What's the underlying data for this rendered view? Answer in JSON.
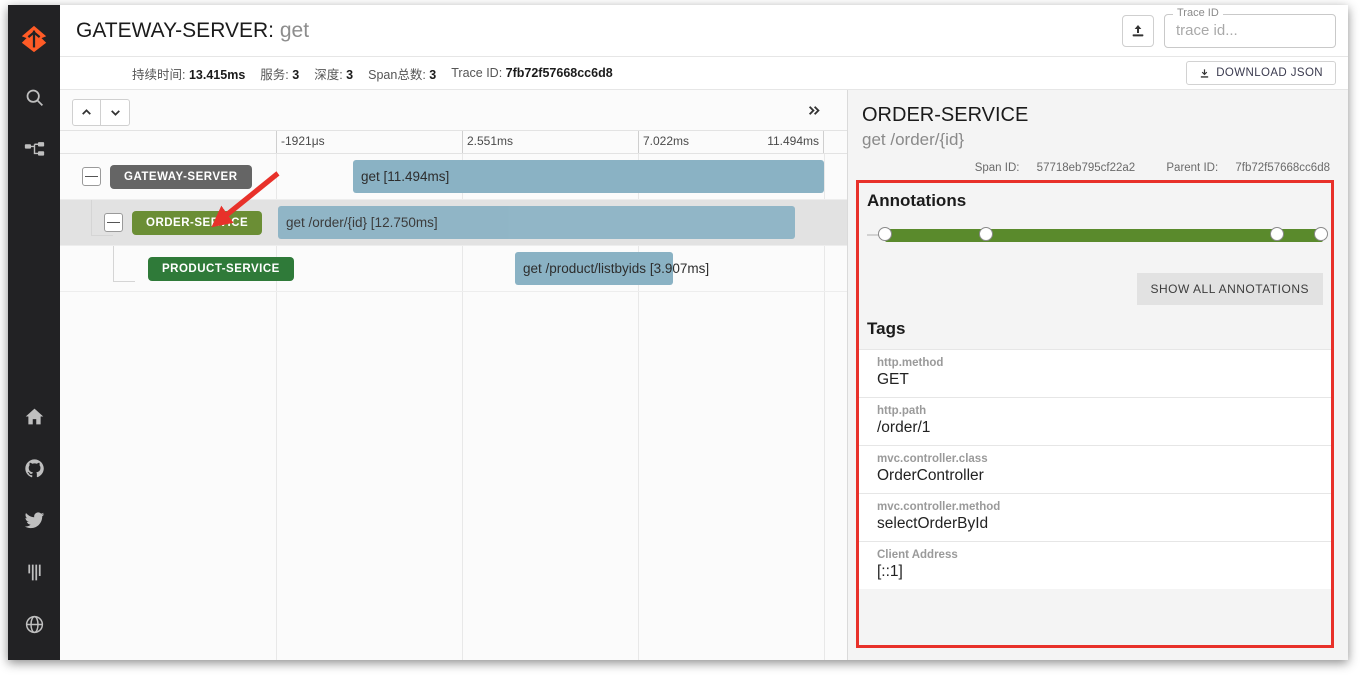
{
  "rail": {
    "items": [
      {
        "name": "zipkin-logo-icon",
        "label": "Zipkin"
      },
      {
        "name": "search-icon",
        "label": "Search"
      },
      {
        "name": "dependencies-icon",
        "label": "Dependencies"
      },
      {
        "name": "home-icon",
        "label": "Home"
      },
      {
        "name": "github-icon",
        "label": "GitHub"
      },
      {
        "name": "twitter-icon",
        "label": "Twitter"
      },
      {
        "name": "gitter-icon",
        "label": "Gitter"
      },
      {
        "name": "globe-icon",
        "label": "Language"
      }
    ]
  },
  "header": {
    "service": "GATEWAY-SERVER",
    "separator": ": ",
    "operation": "get",
    "upload_icon": "upload-icon",
    "traceid_legend": "Trace ID",
    "traceid_value": "",
    "traceid_placeholder": "trace id...",
    "download_label": "DOWNLOAD JSON"
  },
  "meta": [
    {
      "label": "持续时间:",
      "value": "13.415ms"
    },
    {
      "label": "服务:",
      "value": "3"
    },
    {
      "label": "深度:",
      "value": "3"
    },
    {
      "label": "Span总数:",
      "value": "3"
    },
    {
      "label": "Trace ID:",
      "value": "7fb72f57668cc6d8"
    }
  ],
  "timeline": {
    "collapse_all_icon": "chevron-up-icon",
    "expand_all_icon": "chevron-down-icon",
    "expand_detail_icon": "double-chevron-right-icon",
    "ticks": [
      "-1921μs",
      "2.551ms",
      "7.022ms",
      "11.494ms"
    ],
    "rows": [
      {
        "service": "GATEWAY-SERVER",
        "chip_color": "#656565",
        "span_label": "get [11.494ms]",
        "duration": "11.494ms",
        "selected": false,
        "has_toggle": true,
        "depth": 0
      },
      {
        "service": "ORDER-SERVICE",
        "chip_color": "#6b8e35",
        "span_label": "get /order/{id} [12.750ms]",
        "duration": "12.750ms",
        "selected": true,
        "has_toggle": true,
        "depth": 1
      },
      {
        "service": "PRODUCT-SERVICE",
        "chip_color": "#2f7a39",
        "span_label": "get /product/listbyids [3.907ms]",
        "duration": "3.907ms",
        "selected": false,
        "has_toggle": false,
        "depth": 2
      }
    ]
  },
  "detail": {
    "service": "ORDER-SERVICE",
    "operation": "get /order/{id}",
    "span_id_label": "Span ID:",
    "span_id": "57718eb795cf22a2",
    "parent_id_label": "Parent ID:",
    "parent_id": "7fb72f57668cc6d8",
    "annotations_title": "Annotations",
    "show_all_label": "SHOW ALL ANNOTATIONS",
    "annotation_points": [
      4,
      26,
      90,
      100
    ],
    "tags_title": "Tags",
    "tags": [
      {
        "key": "http.method",
        "value": "GET"
      },
      {
        "key": "http.path",
        "value": "/order/1"
      },
      {
        "key": "mvc.controller.class",
        "value": "OrderController"
      },
      {
        "key": "mvc.controller.method",
        "value": "selectOrderById"
      },
      {
        "key": "Client Address",
        "value": "[::1]"
      }
    ]
  },
  "colors": {
    "accent": "#e8312a",
    "span_bar": "#8ab2c4",
    "annotation_bar": "#5a8a2c",
    "logo": "#ff5b26"
  }
}
